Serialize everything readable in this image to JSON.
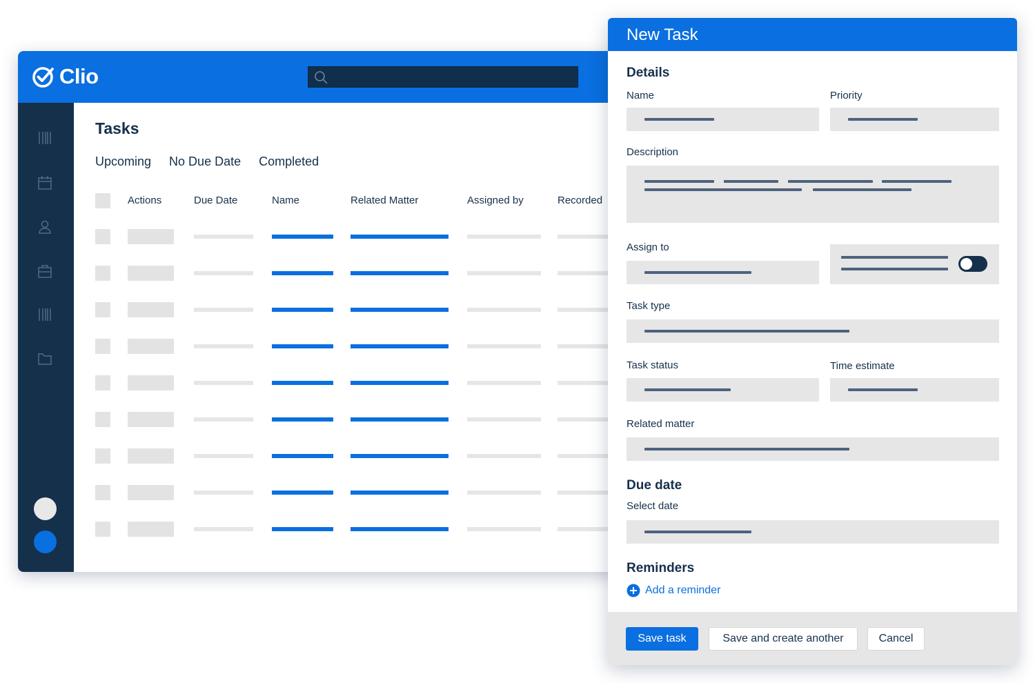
{
  "app": {
    "brand": "Clio",
    "search": {
      "placeholder": ""
    },
    "colors": {
      "brand_blue": "#0a6fe0",
      "navy": "#15304b",
      "skeleton": "#e6e6e6"
    },
    "sidebar": {
      "icons": [
        "billing-barcode-icon",
        "calendar-icon",
        "contacts-person-icon",
        "matters-briefcase-icon",
        "activities-barcode-icon",
        "documents-folder-icon"
      ]
    },
    "page_title": "Tasks",
    "tabs": [
      "Upcoming",
      "No Due Date",
      "Completed"
    ],
    "table": {
      "columns": [
        "Actions",
        "Due Date",
        "Name",
        "Related Matter",
        "Assigned by",
        "Recorded"
      ],
      "row_count": 9
    }
  },
  "modal": {
    "title": "New Task",
    "details_heading": "Details",
    "labels": {
      "name": "Name",
      "priority": "Priority",
      "description": "Description",
      "assign_to": "Assign to",
      "task_type": "Task type",
      "task_status": "Task status",
      "time_estimate": "Time estimate",
      "related_matter": "Related matter",
      "select_date": "Select date"
    },
    "due_date_heading": "Due date",
    "reminders_heading": "Reminders",
    "add_reminder": "Add a reminder",
    "buttons": {
      "save": "Save task",
      "save_another": "Save and create another",
      "cancel": "Cancel"
    }
  }
}
